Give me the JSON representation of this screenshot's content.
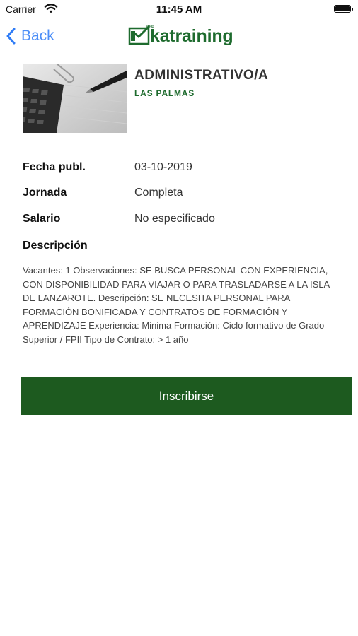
{
  "status_bar": {
    "carrier": "Carrier",
    "time": "11:45 AM"
  },
  "nav": {
    "back_label": "Back",
    "logo_text": "katraining",
    "logo_small": "BFP"
  },
  "job": {
    "title": "ADMINISTRATIVO/A",
    "location": "LAS PALMAS",
    "thumbnail_icon": "calculator-and-pen-image"
  },
  "details": [
    {
      "label": "Fecha publ.",
      "value": "03-10-2019"
    },
    {
      "label": "Jornada",
      "value": "Completa"
    },
    {
      "label": "Salario",
      "value": "No especificado"
    }
  ],
  "description": {
    "title": "Descripción",
    "text": "Vacantes: 1 Observaciones: SE BUSCA PERSONAL CON EXPERIENCIA, CON DISPONIBILIDAD PARA VIAJAR O PARA TRASLADARSE A LA ISLA DE LANZAROTE. Descripción: SE NECESITA PERSONAL PARA FORMACIÓN BONIFICADA Y CONTRATOS DE FORMACIÓN Y APRENDIZAJE Experiencia: Minima Formación: Ciclo formativo de Grado Superior / FPII Tipo de Contrato: > 1 año"
  },
  "actions": {
    "apply_label": "Inscribirse"
  },
  "colors": {
    "brand_green": "#1e6b2e",
    "button_green": "#1d5a1f",
    "ios_blue": "#2f7cf6"
  }
}
